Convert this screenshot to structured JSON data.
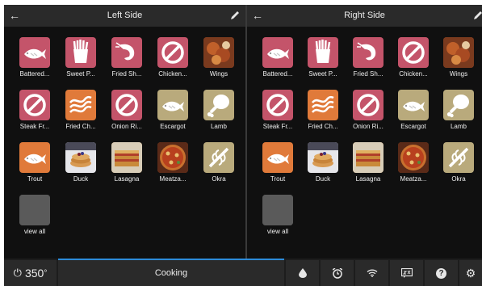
{
  "left_panel": {
    "title": "Left Side",
    "items": [
      {
        "label": "Battered...",
        "icon": "fish-icon",
        "color": "#c4546a"
      },
      {
        "label": "Sweet P...",
        "icon": "fries-icon",
        "color": "#c4546a"
      },
      {
        "label": "Fried Sh...",
        "icon": "shrimp-icon",
        "color": "#c4546a"
      },
      {
        "label": "Chicken...",
        "icon": "no-image-icon",
        "color": "#c4546a"
      },
      {
        "label": "Wings",
        "icon": "wings-photo",
        "color": "#8a3a1e"
      },
      {
        "label": "Steak Fr...",
        "icon": "no-image-icon",
        "color": "#c4546a"
      },
      {
        "label": "Fried Ch...",
        "icon": "bacon-icon",
        "color": "#e07a3a"
      },
      {
        "label": "Onion Ri...",
        "icon": "no-image-icon",
        "color": "#c4546a"
      },
      {
        "label": "Escargot",
        "icon": "fish-icon",
        "color": "#b9aa7c"
      },
      {
        "label": "Lamb",
        "icon": "drumstick-icon",
        "color": "#b9aa7c"
      },
      {
        "label": "Trout",
        "icon": "fish-icon",
        "color": "#e07a3a"
      },
      {
        "label": "Duck",
        "icon": "pancakes-photo",
        "color": "#3a3a4a"
      },
      {
        "label": "Lasagna",
        "icon": "lasagna-photo",
        "color": "#b8742a"
      },
      {
        "label": "Meatza...",
        "icon": "pizza-photo",
        "color": "#a14a22"
      },
      {
        "label": "Okra",
        "icon": "vegetable-icon",
        "color": "#b9aa7c"
      },
      {
        "label": "view all",
        "icon": "view-all-icon",
        "color": "#5a5a5a"
      }
    ]
  },
  "right_panel": {
    "title": "Right Side",
    "items": [
      {
        "label": "Battered...",
        "icon": "fish-icon",
        "color": "#c4546a"
      },
      {
        "label": "Sweet P...",
        "icon": "fries-icon",
        "color": "#c4546a"
      },
      {
        "label": "Fried Sh...",
        "icon": "shrimp-icon",
        "color": "#c4546a"
      },
      {
        "label": "Chicken...",
        "icon": "no-image-icon",
        "color": "#c4546a"
      },
      {
        "label": "Wings",
        "icon": "wings-photo",
        "color": "#8a3a1e"
      },
      {
        "label": "Steak Fr...",
        "icon": "no-image-icon",
        "color": "#c4546a"
      },
      {
        "label": "Fried Ch...",
        "icon": "bacon-icon",
        "color": "#e07a3a"
      },
      {
        "label": "Onion Ri...",
        "icon": "no-image-icon",
        "color": "#c4546a"
      },
      {
        "label": "Escargot",
        "icon": "fish-icon",
        "color": "#b9aa7c"
      },
      {
        "label": "Lamb",
        "icon": "drumstick-icon",
        "color": "#b9aa7c"
      },
      {
        "label": "Trout",
        "icon": "fish-icon",
        "color": "#e07a3a"
      },
      {
        "label": "Duck",
        "icon": "pancakes-photo",
        "color": "#3a3a4a"
      },
      {
        "label": "Lasagna",
        "icon": "lasagna-photo",
        "color": "#b8742a"
      },
      {
        "label": "Meatza...",
        "icon": "pizza-photo",
        "color": "#a14a22"
      },
      {
        "label": "Okra",
        "icon": "vegetable-icon",
        "color": "#b9aa7c"
      },
      {
        "label": "view all",
        "icon": "view-all-icon",
        "color": "#5a5a5a"
      }
    ]
  },
  "footer": {
    "temperature": "350",
    "temperature_unit": "°",
    "mode_label": "Cooking",
    "icons": [
      "drop-icon",
      "alarm-icon",
      "wifi-icon",
      "chat-icon",
      "help-icon",
      "gear-icon"
    ]
  },
  "colors": {
    "accent": "#2d8bd9",
    "panel_bg": "#101010",
    "header_bg": "#2a2a2a"
  }
}
